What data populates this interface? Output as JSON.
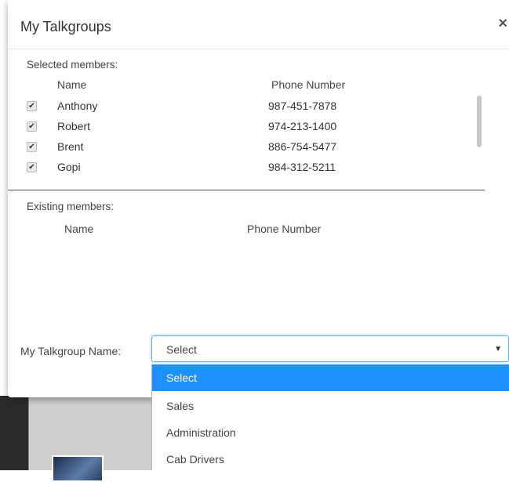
{
  "modal": {
    "title": "My Talkgroups",
    "close_label": "×"
  },
  "selected": {
    "label": "Selected members:",
    "col_name": "Name",
    "col_phone": "Phone Number",
    "rows": [
      {
        "name": "Anthony",
        "phone": "987-451-7878",
        "checked": true
      },
      {
        "name": "Robert",
        "phone": "974-213-1400",
        "checked": true
      },
      {
        "name": "Brent",
        "phone": "886-754-5477",
        "checked": true
      },
      {
        "name": "Gopi",
        "phone": "984-312-5211",
        "checked": true
      }
    ]
  },
  "existing": {
    "label": "Existing members:",
    "col_name": "Name",
    "col_phone": "Phone Number"
  },
  "talkgroup": {
    "label": "My Talkgroup Name:",
    "value": "Select",
    "arrow": "▼",
    "options": [
      "Select",
      "Sales",
      "Administration",
      "Cab Drivers"
    ],
    "highlighted_index": 0
  },
  "colors": {
    "highlight": "#1e90ff",
    "focus_border": "#66afe9"
  }
}
